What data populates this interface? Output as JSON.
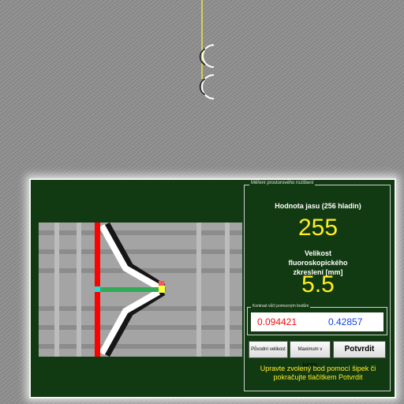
{
  "dialog": {
    "group_title": "Měření prostorového rozlišení",
    "brightness_label": "Hodnota jasu (256 hladin)",
    "brightness_value": "255",
    "size_label": "Velikost fluoroskopického zkreslení [mm]",
    "size_value": "5.5",
    "contrast_group_title": "Kontrast vůči pomocným bodům",
    "contrast_red": "0.094421",
    "contrast_blue": "0.42857",
    "buttons": {
      "original": "Původní velikost",
      "maximum": "Maximum v kolmici",
      "confirm": "Potvrdit"
    },
    "hint": "Upravte zvolený bod pomocí šipek či pokračujte tlačítkem Potvrdit"
  },
  "colors": {
    "dialog_bg": "#123a12",
    "accent_yellow": "#ffee22",
    "contrast_red": "#ee1111",
    "contrast_blue": "#1144ee",
    "marker_red": "#ff0000",
    "marker_green": "#33aa55",
    "marker_cyan": "#22dddd"
  }
}
